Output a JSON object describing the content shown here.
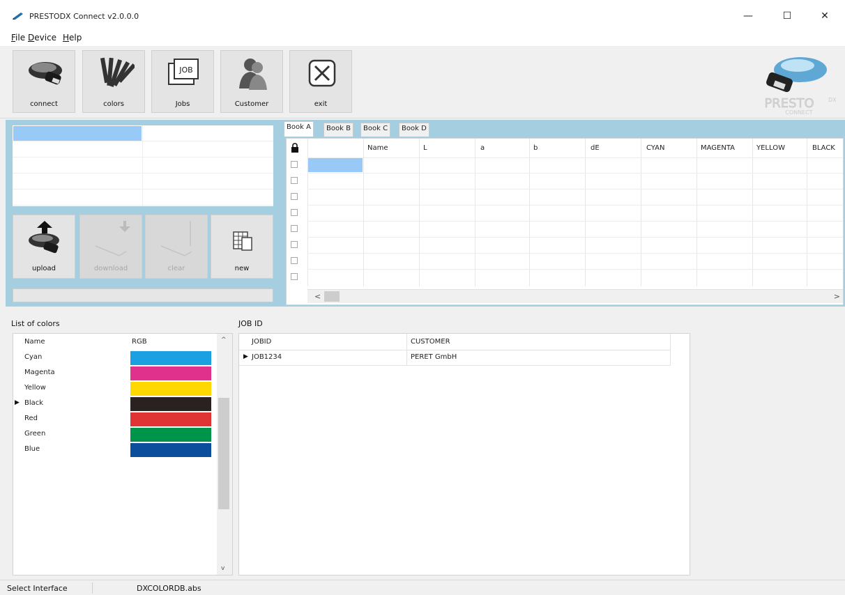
{
  "window": {
    "title": "PRESTODX Connect v2.0.0.0",
    "minimize_glyph": "—",
    "maximize_glyph": "☐",
    "close_glyph": "✕"
  },
  "menu": [
    {
      "label_rest": "ile",
      "accel": "F"
    },
    {
      "label_rest": "evice",
      "accel": "D"
    },
    {
      "label_rest": "elp",
      "accel": "H"
    }
  ],
  "toolbar": {
    "connect": "connect",
    "colors": "colors",
    "jobs": "Jobs",
    "customer": "Customer",
    "exit": "exit",
    "job_icon_text": "JOB"
  },
  "brand": {
    "name": "PRESTO",
    "suffix": "DX",
    "sub": "CONNECT"
  },
  "panel_buttons": {
    "upload": "upload",
    "download": "download",
    "clear": "clear",
    "new": "new"
  },
  "tabs": [
    "Book A",
    "Book B",
    "Book C",
    "Book D"
  ],
  "grid": {
    "columns": [
      "Name",
      "L",
      "a",
      "b",
      "dE",
      "CYAN",
      "MAGENTA",
      "YELLOW",
      "BLACK"
    ],
    "row_count": 8,
    "scroll_left": "<",
    "scroll_right": ">"
  },
  "colors_list": {
    "label": "List of colors",
    "headers": [
      "Name",
      "RGB"
    ],
    "rows": [
      {
        "name": "Cyan",
        "color": "#1ba1e2"
      },
      {
        "name": "Magenta",
        "color": "#e0328c"
      },
      {
        "name": "Yellow",
        "color": "#ffd800"
      },
      {
        "name": "Black",
        "color": "#2a2220"
      },
      {
        "name": "Red",
        "color": "#e03434"
      },
      {
        "name": "Green",
        "color": "#00934a"
      },
      {
        "name": "Blue",
        "color": "#0b4f9c"
      }
    ],
    "selected_row_glyph": "▶",
    "scroll_up": "^",
    "scroll_down": "v"
  },
  "jobs": {
    "label": "JOB ID",
    "headers": [
      "JOBID",
      "CUSTOMER"
    ],
    "rows": [
      {
        "jobid": "JOB1234",
        "customer": "PERET GmbH"
      }
    ],
    "row_glyph": "▶"
  },
  "status": {
    "left": "Select Interface",
    "db": "DXCOLORDB.abs"
  }
}
